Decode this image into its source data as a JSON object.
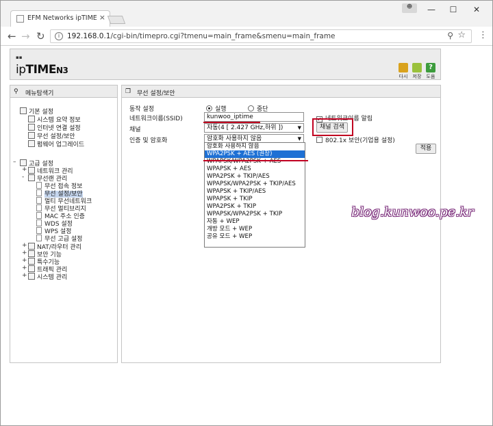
{
  "browser": {
    "tab_title": "EFM Networks ipTIME N",
    "url_host": "192.168.0.1",
    "url_path": "/cgi-bin/timepro.cgi?tmenu=main_frame&smenu=main_frame"
  },
  "router": {
    "brand": "ipTIME",
    "brand_ip": "ip",
    "brand_time": "TIME",
    "model": "N3",
    "header_buttons": [
      "다시",
      "저장",
      "도움"
    ],
    "header_colors": [
      "#d9a21d",
      "#9ac13c",
      "#3d9c3d"
    ]
  },
  "left_panel": {
    "title": "메뉴탐색기",
    "basic": {
      "label": "기본 설정",
      "items": [
        "시스템 요약 정보",
        "인터넷 연결 설정",
        "무선 설정/보안",
        "펌웨어 업그레이드"
      ]
    },
    "advanced": {
      "label": "고급 설정",
      "items": [
        {
          "label": "네트워크 관리",
          "sign": "+"
        },
        {
          "label": "무선랜 관리",
          "sign": "-"
        }
      ],
      "wireless_items": [
        "무선 접속 정보",
        "무선 설정/보안",
        "멀티 무선네트워크",
        "무선 멀티브리지",
        "MAC 주소 인증",
        "WDS 설정",
        "WPS 설정",
        "무선 고급 설정"
      ],
      "more_items": [
        "NAT/라우터 관리",
        "보안 기능",
        "특수기능",
        "트래픽 관리",
        "시스템 관리"
      ]
    }
  },
  "right_panel": {
    "title": "무선 설정/보안",
    "mode_label": "동작 설정",
    "mode_on": "실행",
    "mode_off": "중단",
    "ssid_label": "네트워크이름(SSID)",
    "ssid_value": "kunwoo_iptime",
    "broadcast_label": "네트워크이름 알림",
    "channel_label": "채널",
    "channel_value": "자동(4 [ 2.427 GHz,하위 ])",
    "channel_search_button": "채널 검색",
    "auth_label": "인증 및 암호화",
    "auth_value": "암호화 사용하지 않음",
    "enterprise_label": "802.1x 보안(기업용 설정)",
    "apply_button": "적용",
    "dropdown_options": [
      "암호화 사용하지 않음",
      "WPA2PSK + AES (권장)",
      "WPAPSK/WPA2PSK + AES",
      "WPAPSK + AES",
      "WPA2PSK + TKIP/AES",
      "WPAPSK/WPA2PSK + TKIP/AES",
      "WPAPSK + TKIP/AES",
      "WPAPSK + TKIP",
      "WPA2PSK + TKIP",
      "WPAPSK/WPA2PSK + TKIP",
      "자동 + WEP",
      "개방 모드 + WEP",
      "공유 모드 + WEP"
    ],
    "highlighted_index": 1,
    "annotation_color": "#c00020"
  },
  "watermark": "blog.kunwoo.pe.kr"
}
